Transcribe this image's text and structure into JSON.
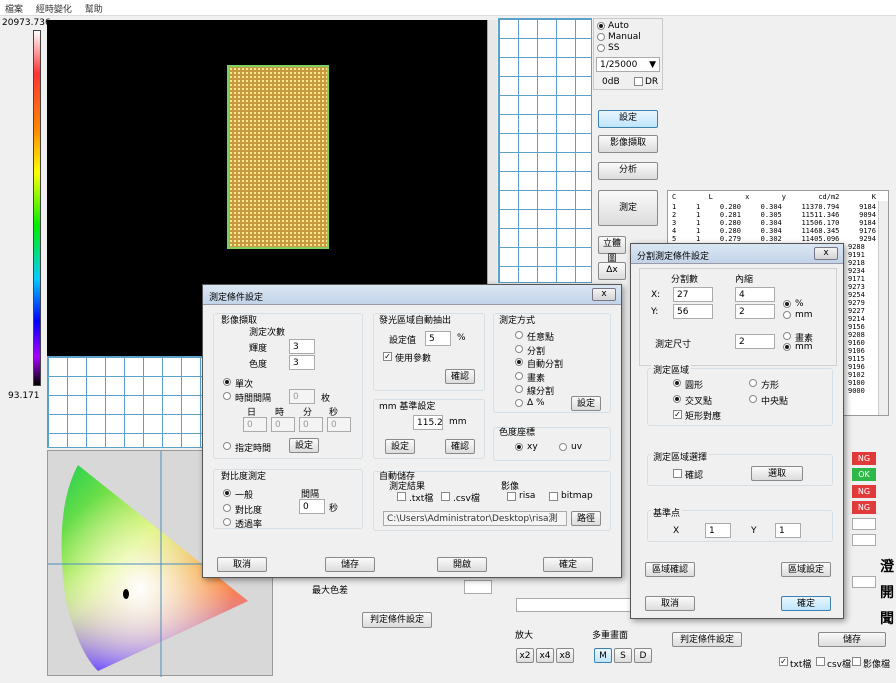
{
  "menu": [
    "檔案",
    "經時變化",
    "幫助"
  ],
  "scale": {
    "max": "20973.736",
    "min": "93.171"
  },
  "right_panel": {
    "auto": "Auto",
    "manual": "Manual",
    "ss": "SS",
    "shutter": "1/25000",
    "gain": "0dB",
    "dr": "DR",
    "settings": "設定",
    "capture": "影像擷取",
    "analyze": "分析",
    "measure": "測定",
    "stand": "立體圖",
    "delta": "Δx"
  },
  "table": {
    "headers": [
      "C",
      "L",
      "x",
      "y",
      "cd/m2",
      "K"
    ],
    "rows": [
      [
        "1",
        "1",
        "0.280",
        "0.304",
        "11370.794",
        "9184"
      ],
      [
        "2",
        "1",
        "0.281",
        "0.305",
        "11511.346",
        "9094"
      ],
      [
        "3",
        "1",
        "0.280",
        "0.304",
        "11506.170",
        "9184"
      ],
      [
        "4",
        "1",
        "0.280",
        "0.304",
        "11468.345",
        "9176"
      ],
      [
        "5",
        "1",
        "0.279",
        "0.302",
        "11405.096",
        "9294"
      ]
    ],
    "k_extra": [
      "9288",
      "9191",
      "9218",
      "9234",
      "9171",
      "9273",
      "9254",
      "9279",
      "9227",
      "9214",
      "9156",
      "9208",
      "9160",
      "9106",
      "9115",
      "9196",
      "9102",
      "9100",
      "9000"
    ]
  },
  "status": [
    "NG",
    "OK",
    "NG",
    "NG"
  ],
  "bottom": {
    "max_diff": "最大色差",
    "judge_btn": "判定條件設定",
    "zoom": "放大",
    "zoom_btns": [
      "x2",
      "x4",
      "x8"
    ],
    "multi": "多重畫面",
    "multi_btns": [
      "M",
      "S",
      "D"
    ],
    "judge_btn2": "判定條件設定",
    "save_btn": "儲存",
    "txt": "txt檔",
    "csv": "csv檔",
    "img": "影像檔",
    "side_chars": [
      "澄",
      "開",
      "聞"
    ]
  },
  "dlg1": {
    "title": "測定條件設定",
    "close": "x",
    "capture": {
      "header": "影像擷取",
      "count_label": "測定次數",
      "lum_label": "輝度",
      "lum": "3",
      "color_label": "色度",
      "color": "3",
      "single": "單次",
      "interval": "時間間隔",
      "interval_val": "0",
      "interval_unit": "枚",
      "time_heads": [
        "日",
        "時",
        "分",
        "秒"
      ],
      "time_vals": [
        "0",
        "0",
        "0",
        "0"
      ],
      "specified": "指定時間",
      "set_btn": "設定"
    },
    "contrast": {
      "header": "對比度測定",
      "normal": "一般",
      "contrast": "對比度",
      "trans": "透過率",
      "interval": "間隔",
      "interval_val": "0",
      "unit": "秒"
    },
    "auto": {
      "header": "發光區域自動抽出",
      "set_val_label": "設定值",
      "set_val": "5",
      "pct": "%",
      "use_param": "使用參數",
      "confirm": "確認"
    },
    "mm": {
      "header": "mm 基準設定",
      "val": "115.2",
      "unit": "mm",
      "set": "設定",
      "confirm": "確認"
    },
    "method": {
      "header": "測定方式",
      "opts": [
        "任意點",
        "分割",
        "自動分割",
        "畫素",
        "線分割",
        "Δ %"
      ],
      "set": "設定"
    },
    "coord": {
      "header": "色度座標",
      "xy": "xy",
      "uv": "uv"
    },
    "autosave": {
      "header": "自動儲存",
      "result": "測定結果",
      "txt": ".txt檔",
      "csv": ".csv檔",
      "image": "影像",
      "risa": "risa",
      "bitmap": "bitmap",
      "path": "C:\\Users\\Administrator\\Desktop\\risa測",
      "path_btn": "路徑"
    },
    "cancel": "取消",
    "save": "儲存",
    "open": "開啟",
    "ok": "確定"
  },
  "dlg2": {
    "title": "分割測定條件設定",
    "close": "x",
    "div_label": "分割數",
    "inner_label": "內縮",
    "x_label": "X:",
    "y_label": "Y:",
    "div_x": "27",
    "div_y": "56",
    "in_x": "4",
    "in_y": "2",
    "pct": "%",
    "mm": "mm",
    "size_label": "測定尺寸",
    "size": "2",
    "pixel": "畫素",
    "mm2": "mm",
    "area": {
      "header": "測定區域",
      "circle": "圓形",
      "square": "方形",
      "cross": "交叉點",
      "center": "中央點",
      "rect": "矩形對應"
    },
    "select": {
      "header": "測定區域選擇",
      "confirm": "確認",
      "choose": "選取"
    },
    "base": {
      "header": "基準点",
      "x": "X",
      "xv": "1",
      "y": "Y",
      "yv": "1"
    },
    "area_confirm": "區域確認",
    "area_set": "區域設定",
    "cancel": "取消",
    "ok": "確定"
  },
  "colors": {
    "ng": "#e03a3a",
    "ok": "#2fb84a",
    "glow": "#e8c070"
  }
}
